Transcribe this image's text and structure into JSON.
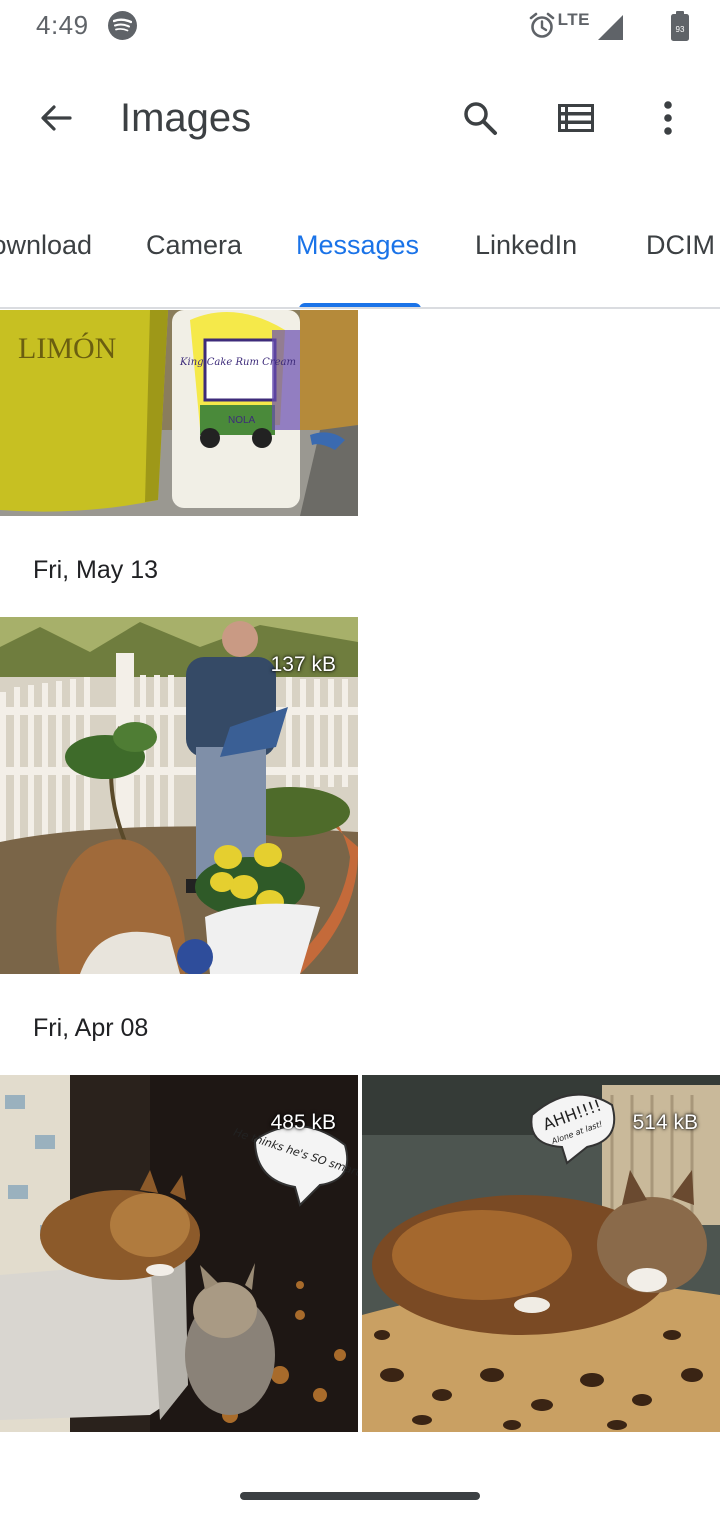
{
  "status_bar": {
    "time": "4:49",
    "network": "LTE",
    "battery": "93",
    "icons": [
      "spotify-icon",
      "alarm-icon",
      "signal-icon",
      "battery-icon"
    ]
  },
  "app_bar": {
    "title": "Images",
    "icons": [
      "back-arrow-icon",
      "search-icon",
      "list-view-icon",
      "more-vert-icon"
    ]
  },
  "tabs": [
    {
      "label": "Download",
      "active": false
    },
    {
      "label": "Camera",
      "active": false
    },
    {
      "label": "Messages",
      "active": true
    },
    {
      "label": "LinkedIn",
      "active": false
    },
    {
      "label": "DCIM",
      "active": false
    }
  ],
  "accent_color": "#1a73e8",
  "groups": [
    {
      "date": "",
      "photos": [
        {
          "description": "Limon cup and King Cake Rum Cream can",
          "size": "",
          "text_in_image": [
            "LIMÓN",
            "King Cake Rum Cream",
            "NOLA"
          ]
        }
      ]
    },
    {
      "date": "Fri, May 13",
      "photos": [
        {
          "description": "Child with lemon tree, man reading in garden",
          "size": "137 kB"
        }
      ]
    },
    {
      "date": "Fri, Apr 08",
      "photos": [
        {
          "description": "Cat lying on white box",
          "size": "485 kB",
          "text_in_image": [
            "He thinks he's SO smart!!"
          ]
        },
        {
          "description": "Cat sleeping on leopard print bed",
          "size": "514 kB",
          "text_in_image": [
            "AHH!!!!",
            "Alone at last!"
          ]
        }
      ]
    }
  ]
}
